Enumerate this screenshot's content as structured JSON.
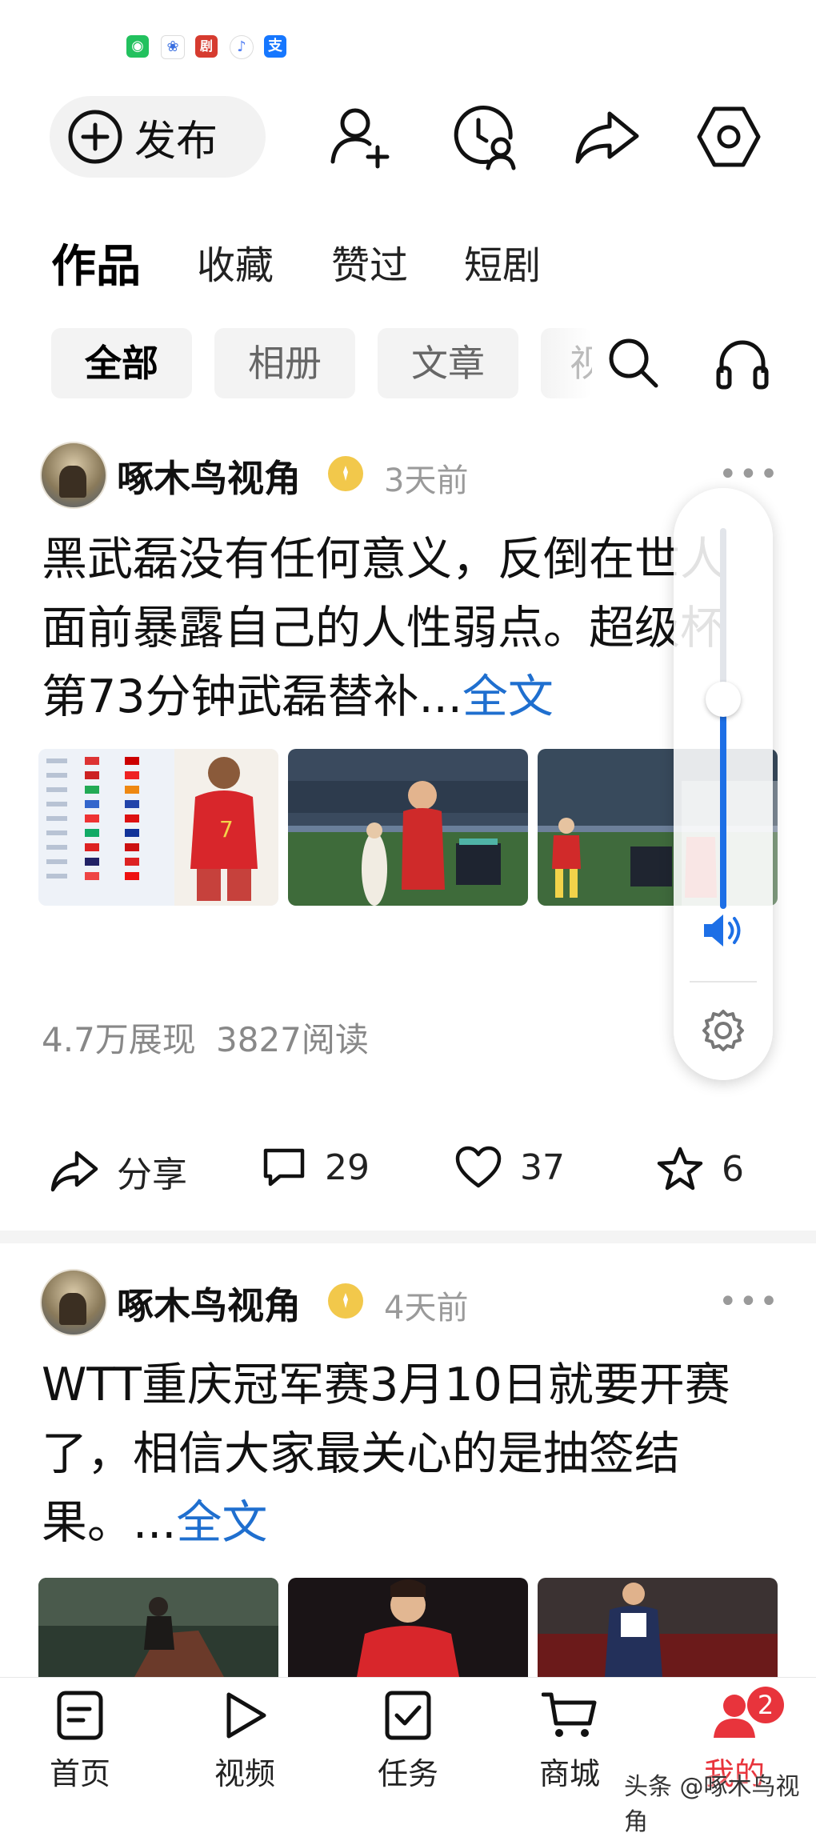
{
  "status_bar": {
    "apps": [
      {
        "name": "wechat-icon",
        "color": "#22c15e",
        "glyph": "◉"
      },
      {
        "name": "baidu-icon",
        "color": "#3a6fe0",
        "glyph": "❀"
      },
      {
        "name": "toutiao-icon",
        "color": "#d63b2f",
        "glyph": "剧"
      },
      {
        "name": "music-icon",
        "color": "#4f7df3",
        "glyph": "♪"
      },
      {
        "name": "alipay-icon",
        "color": "#1677ff",
        "glyph": "支"
      }
    ]
  },
  "top_bar": {
    "publish_label": "发布",
    "icons": [
      "add-friend-icon",
      "history-icon",
      "share-icon",
      "settings-icon"
    ]
  },
  "tabs": [
    "作品",
    "收藏",
    "赞过",
    "短剧"
  ],
  "active_tab": 0,
  "filters": [
    "全部",
    "相册",
    "文章",
    "视"
  ],
  "active_filter": 0,
  "posts": [
    {
      "author": "啄木鸟视角",
      "time": "3天前",
      "text": "黑武磊没有任何意义，反倒在世人面前暴露自己的人性弱点。超级杯第73分钟武磊替补...",
      "more_link": "全文",
      "stats": {
        "impressions": "4.7万展现",
        "reads": "3827阅读"
      },
      "actions": {
        "share": "分享",
        "comments": "29",
        "likes": "37",
        "favorites": "6"
      }
    },
    {
      "author": "啄木鸟视角",
      "time": "4天前",
      "text": "WTT重庆冠军赛3月10日就要开赛了，相信大家最关心的是抽签结果。...",
      "more_link": "全文"
    }
  ],
  "volume_panel": {
    "level": 0.55
  },
  "bottom_nav": [
    {
      "label": "首页",
      "icon": "home-icon"
    },
    {
      "label": "视频",
      "icon": "video-icon"
    },
    {
      "label": "任务",
      "icon": "task-icon"
    },
    {
      "label": "商城",
      "icon": "cart-icon"
    },
    {
      "label": "我的",
      "icon": "profile-icon",
      "badge": "2"
    }
  ],
  "watermark": "头条 @啄木鸟视角",
  "colors": {
    "accent": "#e8343c",
    "link": "#1f6fcf",
    "volume": "#1d6fe6"
  }
}
